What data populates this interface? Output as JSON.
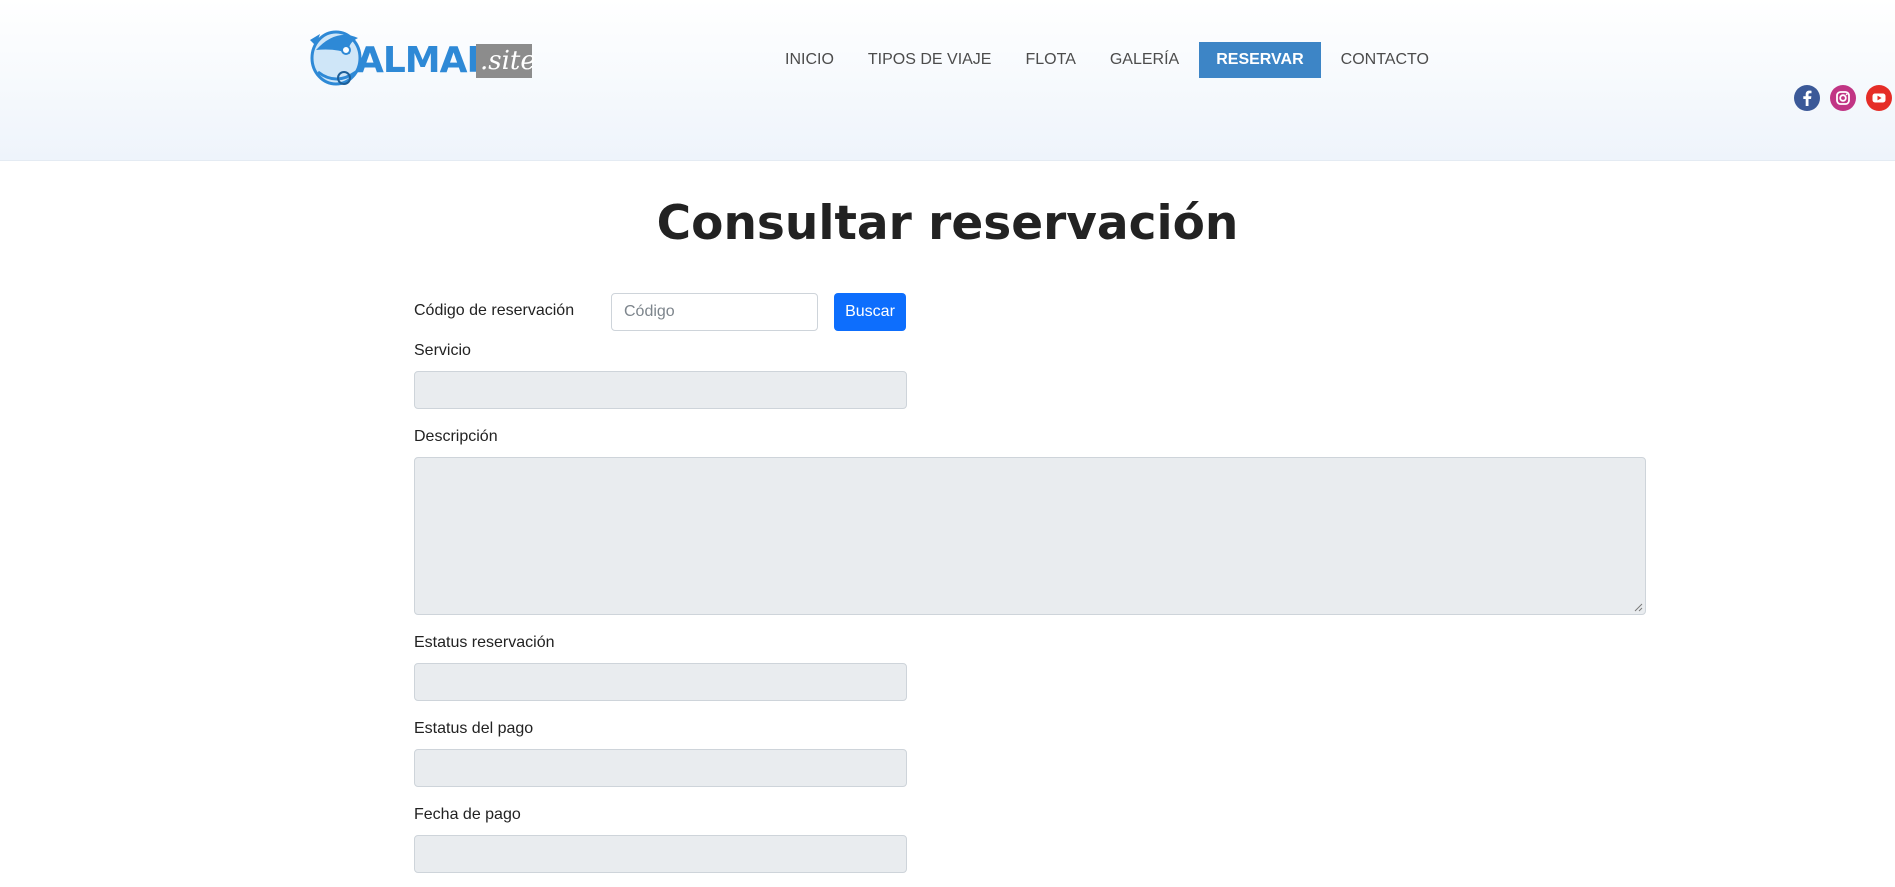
{
  "header": {
    "logo": {
      "brand": "ALMAR",
      "suffix": ".site"
    },
    "nav": [
      {
        "label": "INICIO",
        "active": false
      },
      {
        "label": "TIPOS DE VIAJE",
        "active": false
      },
      {
        "label": "FLOTA",
        "active": false
      },
      {
        "label": "GALERÍA",
        "active": false
      },
      {
        "label": "RESERVAR",
        "active": true
      },
      {
        "label": "CONTACTO",
        "active": false
      }
    ],
    "social": [
      {
        "name": "facebook-icon",
        "color": "#3b5998"
      },
      {
        "name": "instagram-icon",
        "color": "#c13584"
      },
      {
        "name": "youtube-icon",
        "color": "#e52d27"
      }
    ]
  },
  "page": {
    "title": "Consultar reservación"
  },
  "form": {
    "code_label": "Código de reservación",
    "code_placeholder": "Código",
    "search_button": "Buscar",
    "servicio_label": "Servicio",
    "servicio_value": "",
    "descripcion_label": "Descripción",
    "descripcion_value": "",
    "estatus_reservacion_label": "Estatus reservación",
    "estatus_reservacion_value": "",
    "estatus_pago_label": "Estatus del pago",
    "estatus_pago_value": "",
    "fecha_pago_label": "Fecha de pago",
    "fecha_pago_value": ""
  },
  "colors": {
    "nav_active_bg": "#3d85c6",
    "primary_button": "#0d6efd",
    "disabled_field": "#e9ecef"
  }
}
